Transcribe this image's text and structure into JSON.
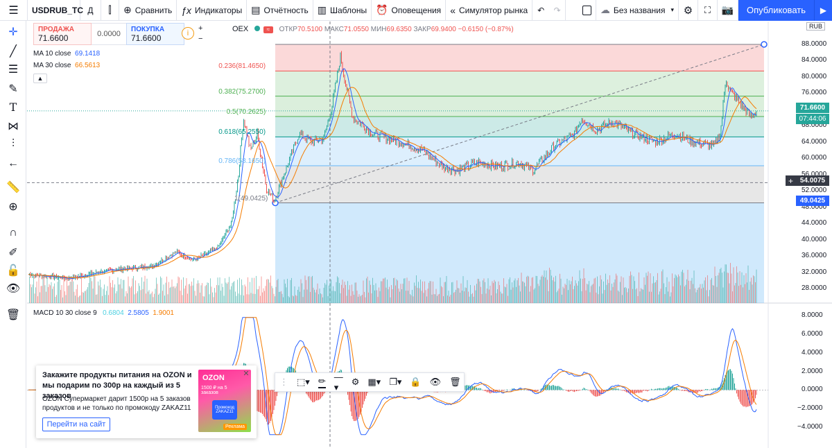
{
  "toolbar": {
    "symbol": "USDRUB_TC",
    "interval": "Д",
    "compare": "Сравнить",
    "indicators": "Индикаторы",
    "reports": "Отчётность",
    "templates": "Шаблоны",
    "alerts": "Оповещения",
    "replay": "Симулятор рынка",
    "layout_name": "Без названия",
    "publish": "Опубликовать"
  },
  "trade": {
    "sell_label": "ПРОДАЖА",
    "sell_value": "71.6600",
    "spread": "0.0000",
    "buy_label": "ПОКУПКА",
    "buy_value": "71.6600",
    "info": "i",
    "plus": "+",
    "minus": "−"
  },
  "ohlc": {
    "exchange": "OEX",
    "open_label": "ОТКР",
    "open": "70.5100",
    "high_label": "МАКС",
    "high": "71.0550",
    "low_label": "МИН",
    "low": "69.6350",
    "close_label": "ЗАКР",
    "close": "69.9400",
    "change": "−0.6150 (−0.87%)"
  },
  "ma": [
    {
      "label": "MA 10 close",
      "value": "69.1418",
      "color": "#2962ff"
    },
    {
      "label": "MA 30 close",
      "value": "66.5613",
      "color": "#f57c00"
    }
  ],
  "macd": {
    "label": "MACD 10 30 close 9",
    "v1": "0.6804",
    "v1_color": "#4dd0e1",
    "v2": "2.5805",
    "v2_color": "#2962ff",
    "v3": "1.9001",
    "v3_color": "#f57c00"
  },
  "price_scale": {
    "currency": "RUB",
    "labels": [
      "88.0000",
      "84.0000",
      "80.0000",
      "76.0000",
      "72.0000",
      "68.0000",
      "64.0000",
      "60.0000",
      "56.0000",
      "52.0000",
      "48.0000",
      "44.0000",
      "40.0000",
      "36.0000",
      "32.0000",
      "28.0000"
    ],
    "last_price": "71.6600",
    "countdown": "07:44:06",
    "cursor_price": "54.0075",
    "low_price": "49.0425"
  },
  "macd_scale": {
    "labels": [
      "8.0000",
      "6.0000",
      "4.0000",
      "2.0000",
      "0.0000",
      "−2.0000",
      "−4.0000"
    ]
  },
  "fib": {
    "levels": [
      {
        "label": "0.236(81.4650)",
        "color": "#ef5350"
      },
      {
        "label": "0.382(75.2700)",
        "color": "#4caf50"
      },
      {
        "label": "0.5(70.2625)",
        "color": "#4caf50"
      },
      {
        "label": "0.618(65.2550)",
        "color": "#009688"
      },
      {
        "label": "0.786(58.1650)",
        "color": "#64b5f6"
      },
      {
        "label": "1(49.0425)",
        "color": "#787b86"
      }
    ]
  },
  "ad": {
    "title": "Закажите продукты питания на OZON и мы подарим по 300р на каждый из 5 заказов",
    "text": "OZON Супермаркет дарит 1500р на 5 заказов продуктов и не только по промокоду ZAKAZ11",
    "button": "Перейти на сайт",
    "image_brand": "OZON",
    "image_promo": "1500 ₽ на 5 заказов",
    "image_code": "Промокод ZAKAZ11",
    "image_tag": "Реклама"
  },
  "colors": {
    "up": "#26a69a",
    "down": "#ef5350",
    "accent": "#2962ff"
  }
}
